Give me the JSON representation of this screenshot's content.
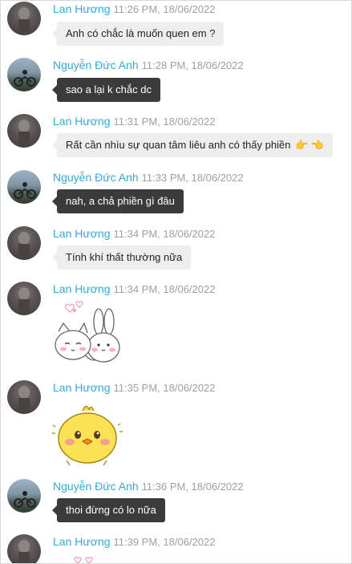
{
  "messages": [
    {
      "sender": "Lan Hương",
      "time": "11:26 PM, 18/06/2022",
      "text": "Anh có chắc là muốn quen em ?"
    },
    {
      "sender": "Nguyễn Đức Anh",
      "time": "11:28 PM, 18/06/2022",
      "text": "sao a lại k chắc dc"
    },
    {
      "sender": "Lan Hương",
      "time": "11:31 PM, 18/06/2022",
      "text": "Rất cần nhìu sự quan tâm liêu anh có thấy phiền",
      "emoji": "👉 👈"
    },
    {
      "sender": "Nguyễn Đức Anh",
      "time": "11:33 PM, 18/06/2022",
      "text": "nah, a chả phiền gì đâu"
    },
    {
      "sender": "Lan Hương",
      "time": "11:34 PM, 18/06/2022",
      "text": "Tính khí thất thường nữa"
    },
    {
      "sender": "Lan Hương",
      "time": "11:34 PM, 18/06/2022",
      "sticker": "bunny-cat-sticker"
    },
    {
      "sender": "Lan Hương",
      "time": "11:35 PM, 18/06/2022",
      "sticker": "yellow-chick-sticker"
    },
    {
      "sender": "Nguyễn Đức Anh",
      "time": "11:36 PM, 18/06/2022",
      "text": "thoi đừng có lo nữa"
    },
    {
      "sender": "Lan Hương",
      "time": "11:39 PM, 18/06/2022",
      "sticker": "hearts-sticker"
    }
  ],
  "colors": {
    "sender_name": "#35a9d6",
    "timestamp": "#a0a0a0",
    "incoming_bubble": "#eeeeee",
    "outgoing_bubble": "#3b3b3b"
  }
}
